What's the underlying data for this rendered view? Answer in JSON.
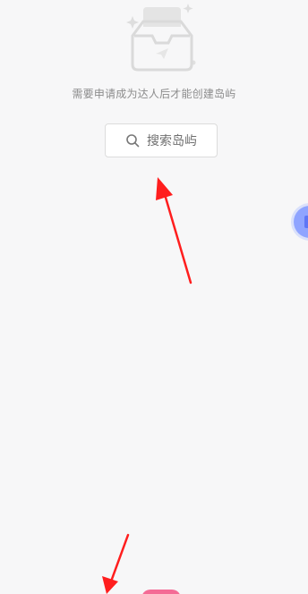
{
  "empty_state": {
    "illustration": "empty-box-icon",
    "message": "需要申请成为达人后才能创建岛屿"
  },
  "search_button": {
    "label": "搜索岛屿",
    "icon": "search-icon"
  },
  "floating_button": {
    "color": "#8fa4ff"
  },
  "bottom_tab": {
    "color": "#f46b95"
  },
  "annotations": {
    "arrow_color": "#ff1e1e"
  }
}
